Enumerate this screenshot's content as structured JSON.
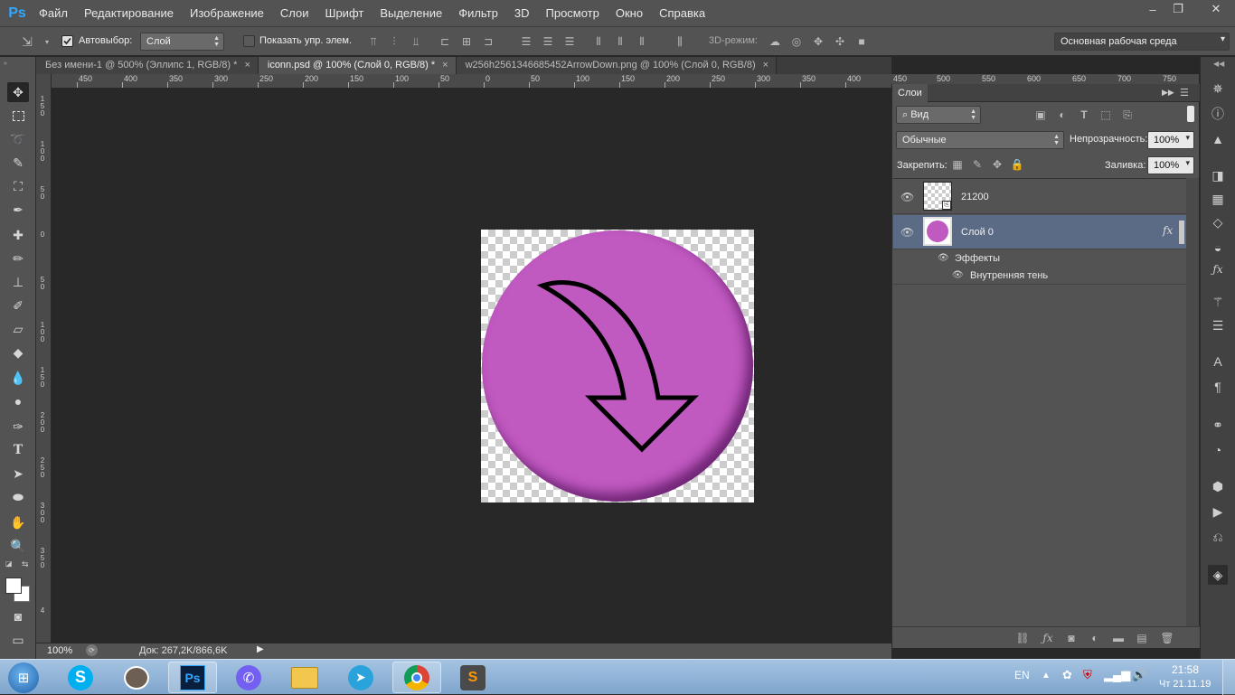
{
  "app": {
    "logo": "Ps",
    "menu": [
      "Файл",
      "Редактирование",
      "Изображение",
      "Слои",
      "Шрифт",
      "Выделение",
      "Фильтр",
      "3D",
      "Просмотр",
      "Окно",
      "Справка"
    ],
    "window_controls": {
      "minimize": "–",
      "restore": "❐",
      "close": "✕"
    }
  },
  "options_bar": {
    "autoselect_label": "Автовыбор:",
    "autoselect_checked": true,
    "autoselect_value": "Слой",
    "show_transform_label": "Показать упр. элем.",
    "mode_3d_label": "3D-режим:",
    "workspace_value": "Основная рабочая среда"
  },
  "tabs": [
    {
      "label": "Без имени-1 @ 500% (Эллипс 1, RGB/8) *",
      "close": "×"
    },
    {
      "label": "iconn.psd @ 100% (Слой 0, RGB/8) *",
      "close": "×"
    },
    {
      "label": "w256h2561346685452ArrowDown.png @ 100% (Слой 0, RGB/8)",
      "close": "×"
    }
  ],
  "ruler_h": [
    "450",
    "400",
    "350",
    "300",
    "250",
    "200",
    "150",
    "100",
    "50",
    "0",
    "50",
    "100",
    "150",
    "200",
    "250",
    "300",
    "350",
    "400"
  ],
  "ruler_h_panel": [
    "450",
    "500",
    "550",
    "600",
    "650",
    "700",
    "750"
  ],
  "ruler_v": [
    [
      "1",
      "5",
      "0"
    ],
    [
      "1",
      "0",
      "0"
    ],
    [
      "5",
      "0"
    ],
    [
      "0"
    ],
    [
      "5",
      "0"
    ],
    [
      "1",
      "0",
      "0"
    ],
    [
      "1",
      "5",
      "0"
    ],
    [
      "2",
      "0",
      "0"
    ],
    [
      "2",
      "5",
      "0"
    ],
    [
      "3",
      "0",
      "0"
    ],
    [
      "3",
      "5",
      "0"
    ],
    [
      "4"
    ]
  ],
  "statusbar": {
    "zoom": "100%",
    "doc_info": "Док: 267,2K/866,6K"
  },
  "layers_panel": {
    "title": "Слои",
    "filter_value": "Вид",
    "blend_mode": "Обычные",
    "opacity_label": "Непрозрачность:",
    "opacity_value": "100%",
    "lock_label": "Закрепить:",
    "fill_label": "Заливка:",
    "fill_value": "100%",
    "layers": [
      {
        "name": "21200",
        "visible": true,
        "selected": false
      },
      {
        "name": "Слой 0",
        "visible": true,
        "selected": true,
        "fx": "fx"
      }
    ],
    "effects_label": "Эффекты",
    "effect_items": [
      "Внутренняя тень"
    ]
  },
  "canvas": {
    "circle_color": "#c059c0"
  },
  "taskbar": {
    "lang": "EN",
    "time": "21:58",
    "date": "Чт 21.11.19",
    "apps": [
      "windows-start",
      "skype",
      "gimp",
      "photoshop",
      "viber",
      "file-explorer",
      "telegram",
      "chrome",
      "sublime-text"
    ]
  }
}
